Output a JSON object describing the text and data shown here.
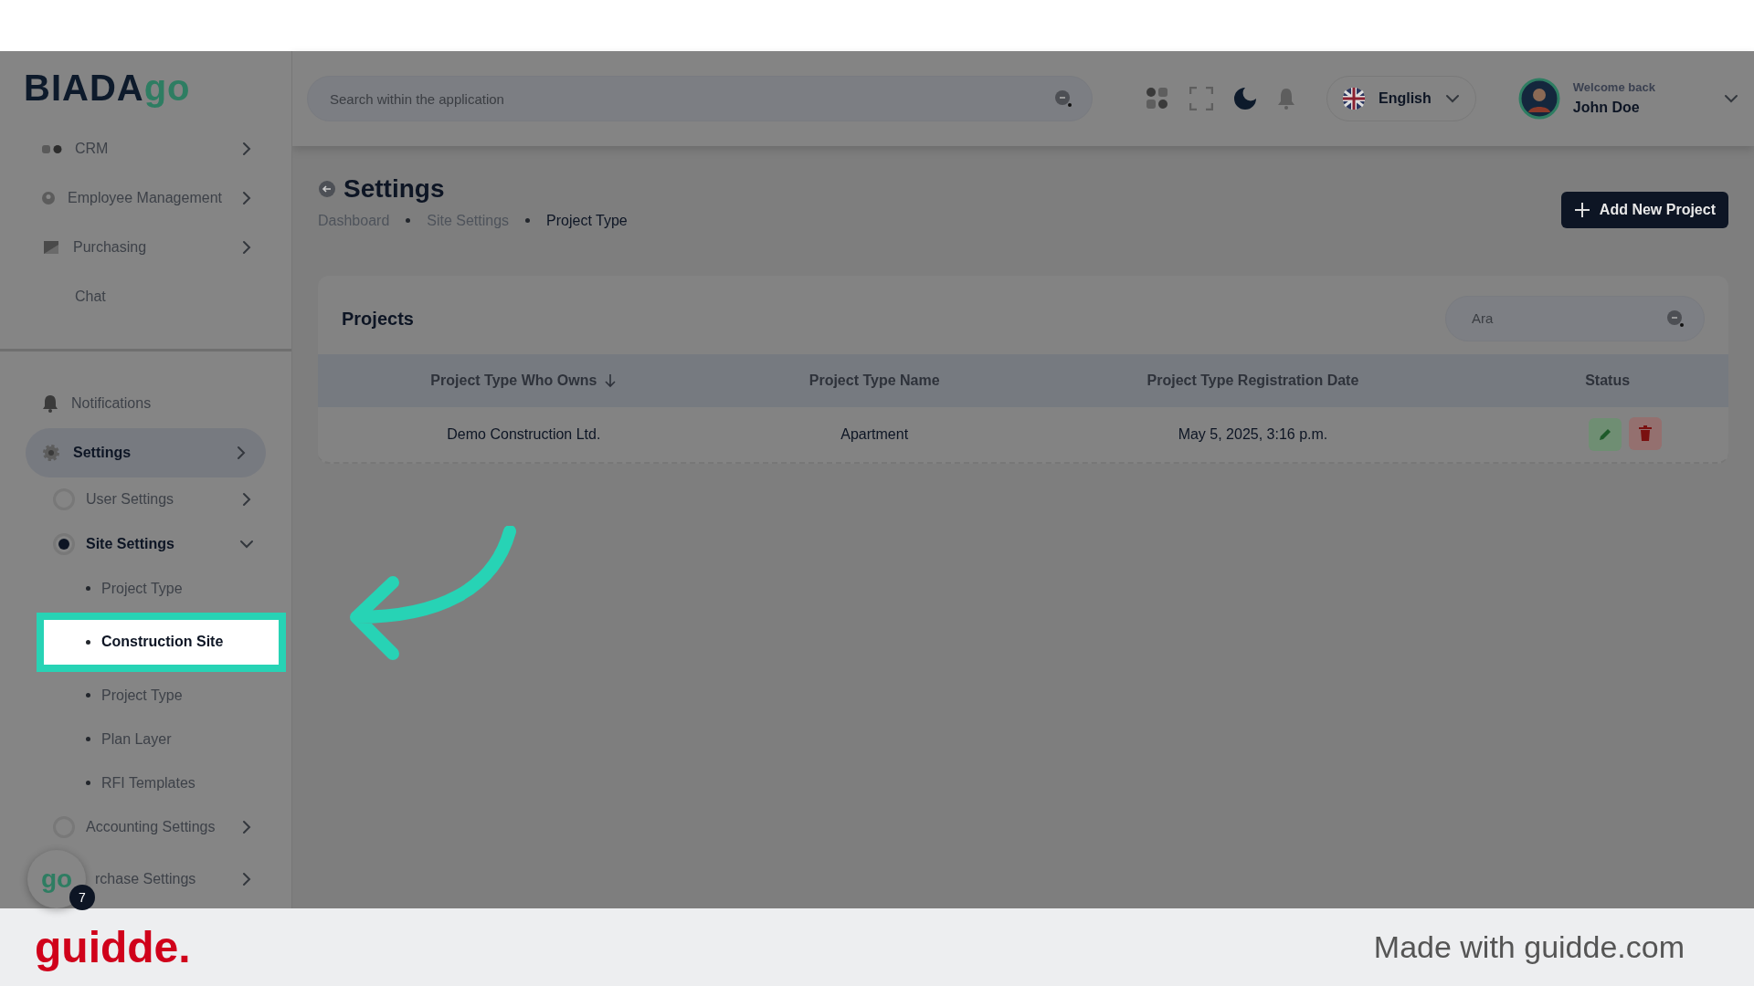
{
  "sidebar": {
    "logo": {
      "wordmark": "BIADA",
      "mark": "go"
    },
    "main_menu": [
      {
        "label": "CRM",
        "arrow": true
      },
      {
        "label": "Employee Management",
        "arrow": true
      },
      {
        "label": "Purchasing",
        "arrow": true
      },
      {
        "label": "Chat",
        "arrow": false
      }
    ],
    "bottom_menu": [
      {
        "label": "Notifications",
        "arrow": false,
        "selected": false
      },
      {
        "label": "Settings",
        "arrow": true,
        "selected": true,
        "children": [
          {
            "label": "User Settings",
            "selected": false,
            "expanded": false
          },
          {
            "label": "Site Settings",
            "selected": true,
            "expanded": true,
            "children": [
              {
                "label": "Project Type",
                "highlighted": false
              },
              {
                "label": "Construction Site",
                "highlighted": true
              },
              {
                "label": "Project Type",
                "highlighted": false
              },
              {
                "label": "Plan Layer",
                "highlighted": false
              },
              {
                "label": "RFI Templates",
                "highlighted": false
              }
            ]
          },
          {
            "label": "Accounting Settings",
            "selected": false,
            "expanded": false
          },
          {
            "label": "rchase Settings",
            "selected": false,
            "expanded": false
          }
        ]
      }
    ],
    "chat_bubble": {
      "logo": "go",
      "badge": "7"
    }
  },
  "header": {
    "search": {
      "placeholder": "Search within the application"
    },
    "language": "English",
    "user": {
      "greeting": "Welcome back",
      "name": "John Doe"
    }
  },
  "page": {
    "title": "Settings",
    "breadcrumb": [
      "Dashboard",
      "Site Settings",
      "Project Type"
    ],
    "primary_button": "Add New Project",
    "card": {
      "title": "Projects",
      "search": {
        "placeholder": "Ara"
      },
      "table": {
        "columns": [
          {
            "label": "Project Type Who Owns",
            "sorted_descending": true
          },
          {
            "label": "Project Type Name"
          },
          {
            "label": "Project Type Registration Date"
          },
          {
            "label": "Status"
          }
        ],
        "rows": [
          {
            "cells": [
              "Demo Construction Ltd.",
              "Apartment",
              "May 5, 2025, 3:16 p.m."
            ]
          }
        ]
      }
    }
  },
  "footer": {
    "brand": "guidde.",
    "credit": "Made with guidde.com"
  }
}
